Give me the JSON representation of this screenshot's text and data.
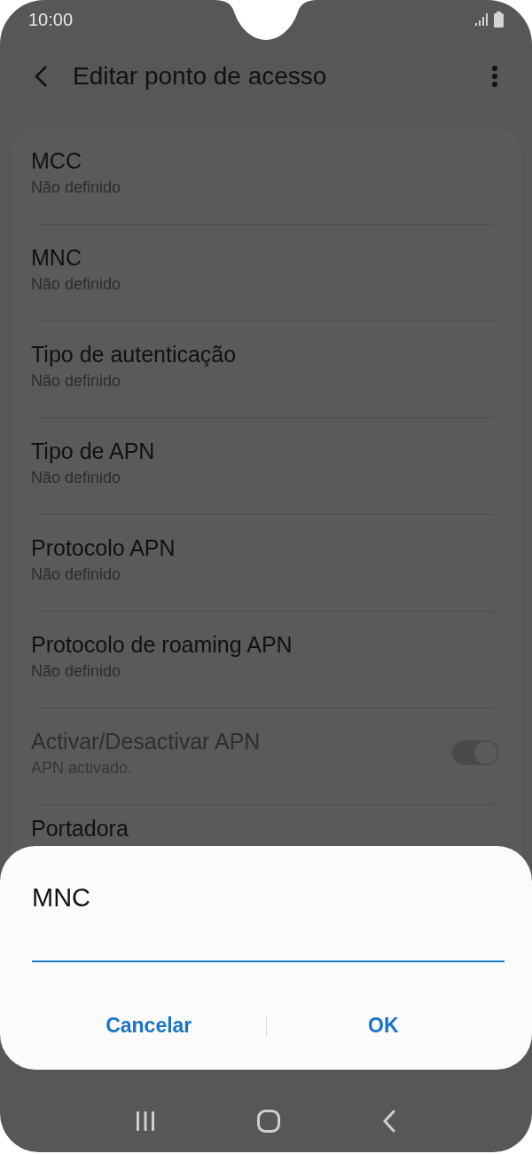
{
  "status_bar": {
    "time": "10:00"
  },
  "app_bar": {
    "title": "Editar ponto de acesso"
  },
  "settings": [
    {
      "kind": "item",
      "title": "MCC",
      "summary": "Não definido",
      "disabled": false
    },
    {
      "kind": "item",
      "title": "MNC",
      "summary": "Não definido",
      "disabled": false
    },
    {
      "kind": "item",
      "title": "Tipo de autenticação",
      "summary": "Não definido",
      "disabled": false
    },
    {
      "kind": "item",
      "title": "Tipo de APN",
      "summary": "Não definido",
      "disabled": false
    },
    {
      "kind": "item",
      "title": "Protocolo APN",
      "summary": "Não definido",
      "disabled": false
    },
    {
      "kind": "item",
      "title": "Protocolo de roaming APN",
      "summary": "Não definido",
      "disabled": false
    },
    {
      "kind": "toggle",
      "title": "Activar/Desactivar APN",
      "summary": "APN activado.",
      "disabled": true,
      "on": true
    },
    {
      "kind": "item",
      "title": "Portadora",
      "disabled": false
    }
  ],
  "dialog": {
    "title": "MNC",
    "buttons": [
      "Cancelar",
      "OK"
    ]
  }
}
